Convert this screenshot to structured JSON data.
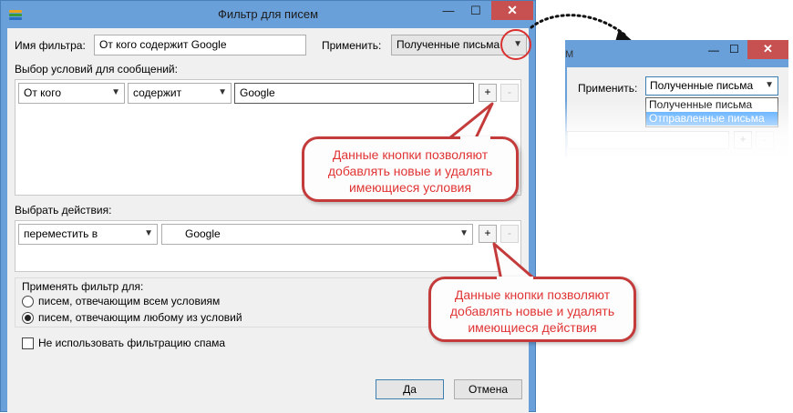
{
  "window": {
    "title": "Фильтр для писем",
    "controls": {
      "minimize": "—",
      "maximize": "☐",
      "close": "✕"
    }
  },
  "filter_name": {
    "label": "Имя фильтра:",
    "value": "От кого содержит Google"
  },
  "apply_to": {
    "label": "Применить:",
    "value": "Полученные письма"
  },
  "conditions": {
    "group_label": "Выбор условий для сообщений:",
    "field": "От кого",
    "operator": "содержит",
    "value": "Google",
    "add_label": "+",
    "remove_label": "-"
  },
  "actions": {
    "group_label": "Выбрать действия:",
    "action": "переместить в",
    "target": "Google",
    "add_label": "+",
    "remove_label": "-"
  },
  "apply_filter": {
    "label": "Применять фильтр для:",
    "option_all": "писем, отвечающим всем условиям",
    "option_any": "писем, отвечающим любому из условий",
    "selected": "any"
  },
  "spam": {
    "label": "Не использовать фильтрацию спама",
    "checked": false
  },
  "buttons": {
    "ok": "Да",
    "cancel": "Отмена"
  },
  "callouts": {
    "conditions": "Данные кнопки позволяют добавлять новые и удалять имеющиеся условия",
    "actions": "Данные кнопки позволяют добавлять новые и удалять имеющиеся действия"
  },
  "inset": {
    "title_fragment": "M",
    "apply_label": "Применить:",
    "apply_value": "Полученные письма",
    "options": [
      "Полученные письма",
      "Отправленные письма"
    ],
    "highlighted_option": "Отправленные письма",
    "add_label": "+",
    "remove_label": "-"
  },
  "colors": {
    "window_frame": "#6aa0da",
    "close_button": "#c75050",
    "callout_border": "#c43b3b",
    "callout_text": "#e03434",
    "highlight": "#3399ff"
  }
}
